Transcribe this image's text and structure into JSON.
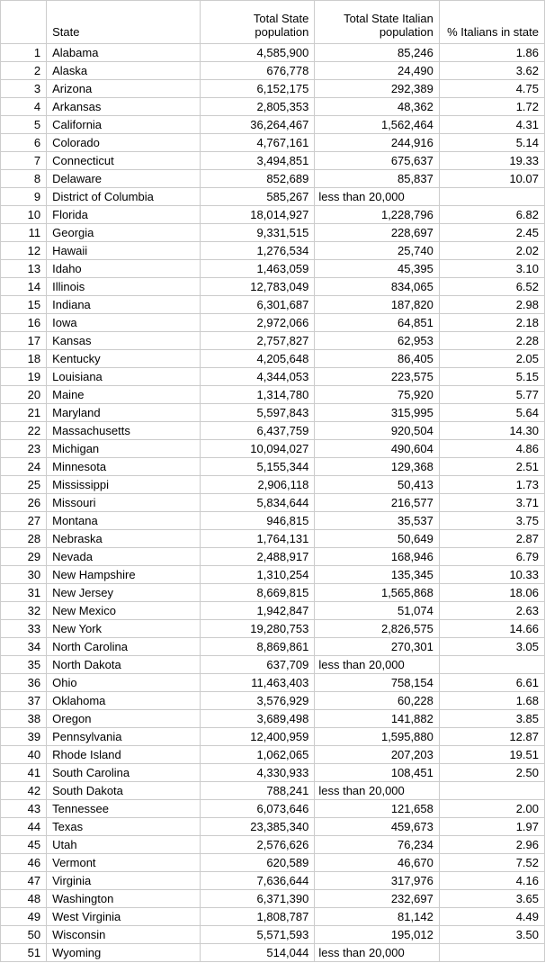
{
  "headers": {
    "idx": "",
    "state": "State",
    "pop": "Total State population",
    "ital": "Total State Italian population",
    "pct": "% Italians in state"
  },
  "rows": [
    {
      "idx": "1",
      "state": "Alabama",
      "pop": "4,585,900",
      "ital": "85,246",
      "pct": "1.86"
    },
    {
      "idx": "2",
      "state": "Alaska",
      "pop": "676,778",
      "ital": "24,490",
      "pct": "3.62"
    },
    {
      "idx": "3",
      "state": "Arizona",
      "pop": "6,152,175",
      "ital": "292,389",
      "pct": "4.75"
    },
    {
      "idx": "4",
      "state": "Arkansas",
      "pop": "2,805,353",
      "ital": "48,362",
      "pct": "1.72"
    },
    {
      "idx": "5",
      "state": "California",
      "pop": "36,264,467",
      "ital": "1,562,464",
      "pct": "4.31"
    },
    {
      "idx": "6",
      "state": "Colorado",
      "pop": "4,767,161",
      "ital": "244,916",
      "pct": "5.14"
    },
    {
      "idx": "7",
      "state": "Connecticut",
      "pop": "3,494,851",
      "ital": "675,637",
      "pct": "19.33"
    },
    {
      "idx": "8",
      "state": "Delaware",
      "pop": "852,689",
      "ital": "85,837",
      "pct": "10.07"
    },
    {
      "idx": "9",
      "state": "District of Columbia",
      "pop": "585,267",
      "ital": "less than 20,000",
      "pct": "",
      "ital_note": true
    },
    {
      "idx": "10",
      "state": "Florida",
      "pop": "18,014,927",
      "ital": "1,228,796",
      "pct": "6.82"
    },
    {
      "idx": "11",
      "state": "Georgia",
      "pop": "9,331,515",
      "ital": "228,697",
      "pct": "2.45"
    },
    {
      "idx": "12",
      "state": "Hawaii",
      "pop": "1,276,534",
      "ital": "25,740",
      "pct": "2.02"
    },
    {
      "idx": "13",
      "state": "Idaho",
      "pop": "1,463,059",
      "ital": "45,395",
      "pct": "3.10"
    },
    {
      "idx": "14",
      "state": "Illinois",
      "pop": "12,783,049",
      "ital": "834,065",
      "pct": "6.52"
    },
    {
      "idx": "15",
      "state": "Indiana",
      "pop": "6,301,687",
      "ital": "187,820",
      "pct": "2.98"
    },
    {
      "idx": "16",
      "state": "Iowa",
      "pop": "2,972,066",
      "ital": "64,851",
      "pct": "2.18"
    },
    {
      "idx": "17",
      "state": "Kansas",
      "pop": "2,757,827",
      "ital": "62,953",
      "pct": "2.28"
    },
    {
      "idx": "18",
      "state": "Kentucky",
      "pop": "4,205,648",
      "ital": "86,405",
      "pct": "2.05"
    },
    {
      "idx": "19",
      "state": "Louisiana",
      "pop": "4,344,053",
      "ital": "223,575",
      "pct": "5.15"
    },
    {
      "idx": "20",
      "state": "Maine",
      "pop": "1,314,780",
      "ital": "75,920",
      "pct": "5.77"
    },
    {
      "idx": "21",
      "state": "Maryland",
      "pop": "5,597,843",
      "ital": "315,995",
      "pct": "5.64"
    },
    {
      "idx": "22",
      "state": "Massachusetts",
      "pop": "6,437,759",
      "ital": "920,504",
      "pct": "14.30"
    },
    {
      "idx": "23",
      "state": "Michigan",
      "pop": "10,094,027",
      "ital": "490,604",
      "pct": "4.86"
    },
    {
      "idx": "24",
      "state": "Minnesota",
      "pop": "5,155,344",
      "ital": "129,368",
      "pct": "2.51"
    },
    {
      "idx": "25",
      "state": "Mississippi",
      "pop": "2,906,118",
      "ital": "50,413",
      "pct": "1.73"
    },
    {
      "idx": "26",
      "state": "Missouri",
      "pop": "5,834,644",
      "ital": "216,577",
      "pct": "3.71"
    },
    {
      "idx": "27",
      "state": "Montana",
      "pop": "946,815",
      "ital": "35,537",
      "pct": "3.75"
    },
    {
      "idx": "28",
      "state": "Nebraska",
      "pop": "1,764,131",
      "ital": "50,649",
      "pct": "2.87"
    },
    {
      "idx": "29",
      "state": "Nevada",
      "pop": "2,488,917",
      "ital": "168,946",
      "pct": "6.79"
    },
    {
      "idx": "30",
      "state": "New Hampshire",
      "pop": "1,310,254",
      "ital": "135,345",
      "pct": "10.33"
    },
    {
      "idx": "31",
      "state": "New Jersey",
      "pop": "8,669,815",
      "ital": "1,565,868",
      "pct": "18.06"
    },
    {
      "idx": "32",
      "state": "New Mexico",
      "pop": "1,942,847",
      "ital": "51,074",
      "pct": "2.63"
    },
    {
      "idx": "33",
      "state": "New York",
      "pop": "19,280,753",
      "ital": "2,826,575",
      "pct": "14.66"
    },
    {
      "idx": "34",
      "state": "North Carolina",
      "pop": "8,869,861",
      "ital": "270,301",
      "pct": "3.05"
    },
    {
      "idx": "35",
      "state": "North Dakota",
      "pop": "637,709",
      "ital": "less than 20,000",
      "pct": "",
      "ital_note": true
    },
    {
      "idx": "36",
      "state": "Ohio",
      "pop": "11,463,403",
      "ital": "758,154",
      "pct": "6.61"
    },
    {
      "idx": "37",
      "state": "Oklahoma",
      "pop": "3,576,929",
      "ital": "60,228",
      "pct": "1.68"
    },
    {
      "idx": "38",
      "state": "Oregon",
      "pop": "3,689,498",
      "ital": "141,882",
      "pct": "3.85"
    },
    {
      "idx": "39",
      "state": "Pennsylvania",
      "pop": "12,400,959",
      "ital": "1,595,880",
      "pct": "12.87"
    },
    {
      "idx": "40",
      "state": "Rhode Island",
      "pop": "1,062,065",
      "ital": "207,203",
      "pct": "19.51"
    },
    {
      "idx": "41",
      "state": "South Carolina",
      "pop": "4,330,933",
      "ital": "108,451",
      "pct": "2.50"
    },
    {
      "idx": "42",
      "state": "South Dakota",
      "pop": "788,241",
      "ital": "less than 20,000",
      "pct": "",
      "ital_note": true
    },
    {
      "idx": "43",
      "state": "Tennessee",
      "pop": "6,073,646",
      "ital": "121,658",
      "pct": "2.00"
    },
    {
      "idx": "44",
      "state": "Texas",
      "pop": "23,385,340",
      "ital": "459,673",
      "pct": "1.97"
    },
    {
      "idx": "45",
      "state": "Utah",
      "pop": "2,576,626",
      "ital": "76,234",
      "pct": "2.96"
    },
    {
      "idx": "46",
      "state": "Vermont",
      "pop": "620,589",
      "ital": "46,670",
      "pct": "7.52"
    },
    {
      "idx": "47",
      "state": "Virginia",
      "pop": "7,636,644",
      "ital": "317,976",
      "pct": "4.16"
    },
    {
      "idx": "48",
      "state": "Washington",
      "pop": "6,371,390",
      "ital": "232,697",
      "pct": "3.65"
    },
    {
      "idx": "49",
      "state": "West Virginia",
      "pop": "1,808,787",
      "ital": "81,142",
      "pct": "4.49"
    },
    {
      "idx": "50",
      "state": "Wisconsin",
      "pop": "5,571,593",
      "ital": "195,012",
      "pct": "3.50"
    },
    {
      "idx": "51",
      "state": "Wyoming",
      "pop": "514,044",
      "ital": "less than 20,000",
      "pct": "",
      "ital_note": true
    }
  ]
}
